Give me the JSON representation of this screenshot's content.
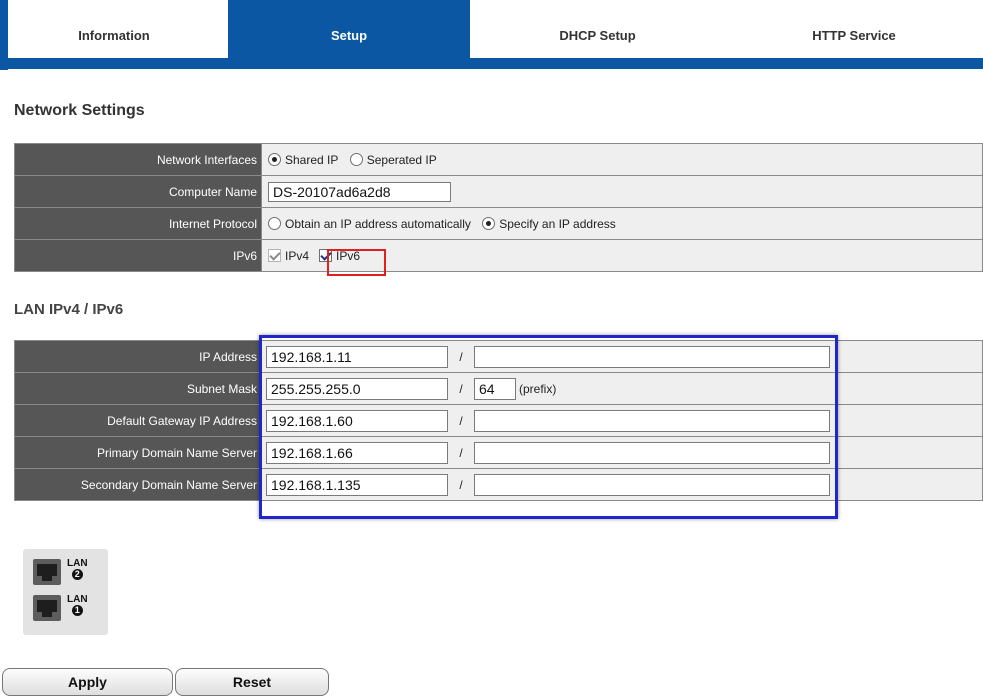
{
  "tabs": [
    {
      "label": "Information",
      "active": false
    },
    {
      "label": "Setup",
      "active": true
    },
    {
      "label": "DHCP Setup",
      "active": false
    },
    {
      "label": "HTTP Service",
      "active": false
    }
  ],
  "network_settings": {
    "title": "Network Settings",
    "interfaces": {
      "label": "Network Interfaces",
      "options": [
        "Shared IP",
        "Seperated IP"
      ],
      "selected": "Shared IP"
    },
    "computer_name": {
      "label": "Computer Name",
      "value": "DS-20107ad6a2d8"
    },
    "protocol": {
      "label": "Internet Protocol",
      "options": [
        "Obtain an IP address automatically",
        "Specify an IP address"
      ],
      "selected": "Specify an IP address"
    },
    "ipv6": {
      "label": "IPv6",
      "ipv4_label": "IPv4",
      "ipv6_label": "IPv6",
      "ipv4_checked": true,
      "ipv4_disabled": true,
      "ipv6_checked": true
    }
  },
  "lan": {
    "title": "LAN IPv4 / IPv6",
    "rows": [
      {
        "label": "IP Address",
        "ipv4": "192.168.1.11",
        "ipv6": ""
      },
      {
        "label": "Subnet Mask",
        "ipv4": "255.255.255.0",
        "prefix": "64",
        "prefix_label": "(prefix)"
      },
      {
        "label": "Default Gateway IP Address",
        "ipv4": "192.168.1.60",
        "ipv6": ""
      },
      {
        "label": "Primary Domain Name Server",
        "ipv4": "192.168.1.66",
        "ipv6": ""
      },
      {
        "label": "Secondary Domain Name Server",
        "ipv4": "192.168.1.135",
        "ipv6": ""
      }
    ],
    "separator": "/"
  },
  "ports": [
    {
      "label": "LAN",
      "number": "2"
    },
    {
      "label": "LAN",
      "number": "1"
    }
  ],
  "buttons": {
    "apply": "Apply",
    "reset": "Reset"
  },
  "colors": {
    "accent": "#0b57a3",
    "label_bg": "#565656",
    "highlight_red": "#e01f1f",
    "highlight_blue": "#2027c8"
  }
}
